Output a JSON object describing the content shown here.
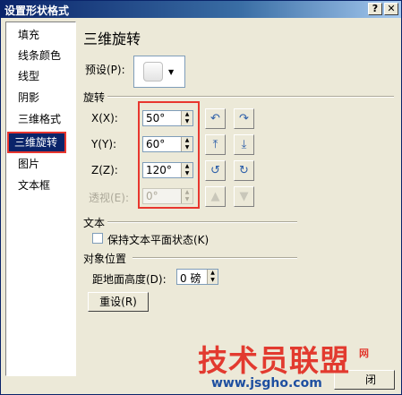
{
  "window": {
    "title": "设置形状格式",
    "help_label": "?",
    "close_label": "✕"
  },
  "nav": {
    "items": [
      {
        "label": "填充"
      },
      {
        "label": "线条颜色"
      },
      {
        "label": "线型"
      },
      {
        "label": "阴影"
      },
      {
        "label": "三维格式"
      },
      {
        "label": "三维旋转",
        "selected": true
      },
      {
        "label": "图片"
      },
      {
        "label": "文本框"
      }
    ]
  },
  "panel": {
    "title": "三维旋转",
    "preset_label": "预设(P):",
    "rotation_header": "旋转",
    "x_label": "X(X):",
    "x_value": "50°",
    "y_label": "Y(Y):",
    "y_value": "60°",
    "z_label": "Z(Z):",
    "z_value": "120°",
    "perspective_label": "透视(E):",
    "perspective_value": "0°",
    "text_header": "文本",
    "keep_flat_label": "保持文本平面状态(K)",
    "keep_flat_checked": false,
    "object_position_header": "对象位置",
    "distance_label": "距地面高度(D):",
    "distance_value": "0 磅",
    "reset_label": "重设(R)"
  },
  "footer": {
    "close_label": "闭"
  },
  "watermark": {
    "brand": "技术员联盟",
    "com": "网",
    "url": "www.jsgho.com"
  },
  "colors": {
    "highlight_red": "#e8362e",
    "selection_bg": "#0a246a",
    "titlebar": "#0a246a"
  }
}
